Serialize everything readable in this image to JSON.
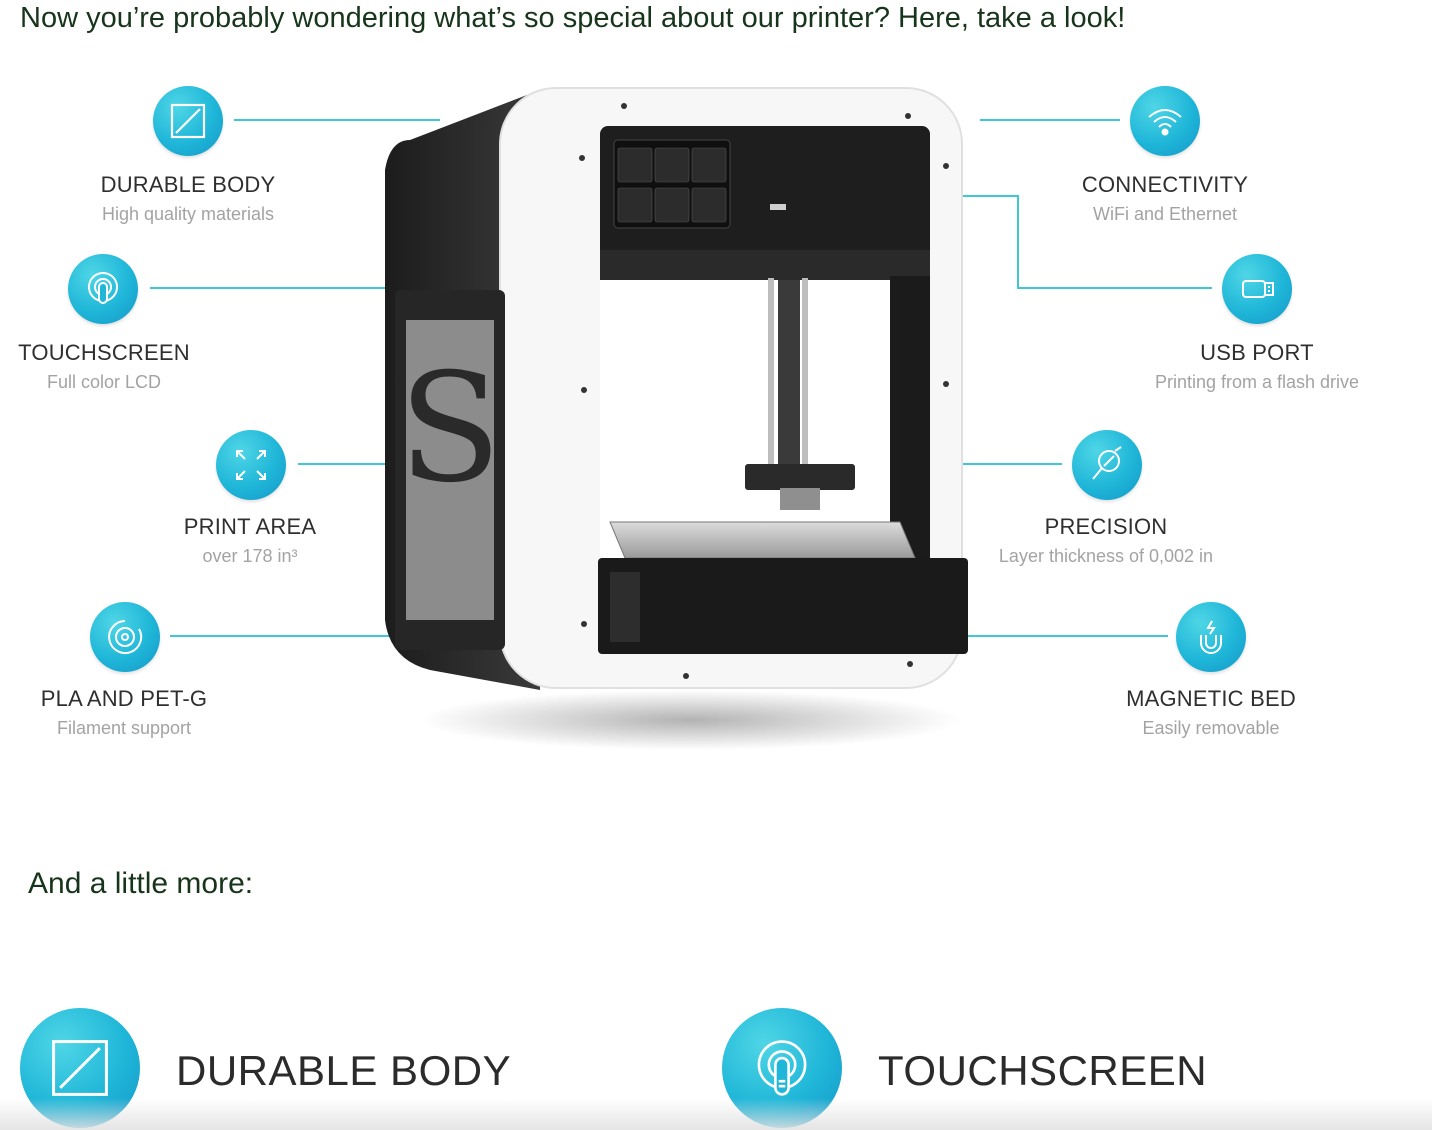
{
  "intro_text": "Now you’re probably wondering what’s so special about our printer? Here, take a look!",
  "more_text": "And a little more:",
  "accent_color": "#1fb6d8",
  "features": [
    {
      "id": "durable-body",
      "icon": "square-slash-icon",
      "title": "DURABLE BODY",
      "subtitle": "High quality materials"
    },
    {
      "id": "touchscreen",
      "icon": "finger-touch-icon",
      "title": "TOUCHSCREEN",
      "subtitle": "Full color LCD"
    },
    {
      "id": "print-area",
      "icon": "expand-arrows-icon",
      "title": "PRINT AREA",
      "subtitle": "over 178 in³"
    },
    {
      "id": "pla-petg",
      "icon": "filament-spool-icon",
      "title": "PLA AND PET-G",
      "subtitle": "Filament support"
    },
    {
      "id": "connectivity",
      "icon": "wifi-icon",
      "title": "CONNECTIVITY",
      "subtitle": "WiFi and Ethernet"
    },
    {
      "id": "usb-port",
      "icon": "usb-drive-icon",
      "title": "USB PORT",
      "subtitle": "Printing from a flash drive"
    },
    {
      "id": "precision",
      "icon": "magnifier-icon",
      "title": "PRECISION",
      "subtitle": "Layer thickness of 0,002 in"
    },
    {
      "id": "magnetic-bed",
      "icon": "magnet-icon",
      "title": "MAGNETIC BED",
      "subtitle": "Easily removable"
    }
  ],
  "bottom_features": [
    {
      "icon": "square-slash-icon",
      "label": "DURABLE BODY"
    },
    {
      "icon": "finger-touch-icon",
      "label": "TOUCHSCREEN"
    }
  ]
}
